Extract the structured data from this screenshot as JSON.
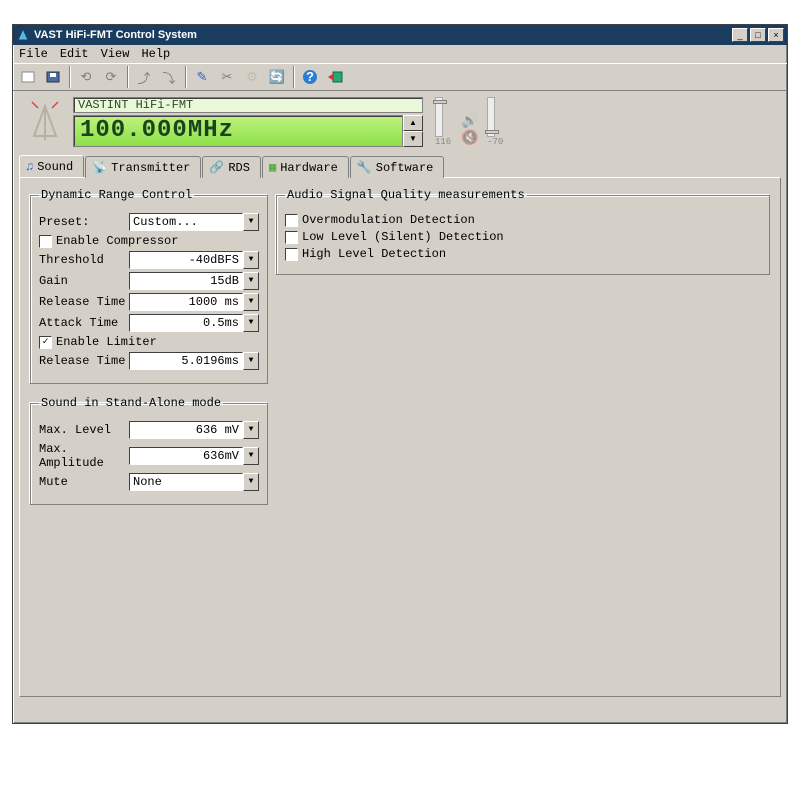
{
  "window": {
    "title": "VAST HiFi-FMT Control System"
  },
  "menus": {
    "file": "File",
    "edit": "Edit",
    "view": "View",
    "help": "Help"
  },
  "lcd": {
    "line1": "VASTINT HiFi-FMT",
    "freq": "100.000MHz"
  },
  "meters": {
    "left_val": "116",
    "right_val": "-70"
  },
  "tabs": {
    "sound": "Sound",
    "transmitter": "Transmitter",
    "rds": "RDS",
    "hardware": "Hardware",
    "software": "Software"
  },
  "groups": {
    "drc": "Dynamic Range Control",
    "standalone": "Sound in Stand-Alone mode",
    "quality": "Audio Signal Quality measurements"
  },
  "drc": {
    "preset_label": "Preset:",
    "preset_value": "Custom...",
    "enable_compressor": "Enable Compressor",
    "threshold_label": "Threshold",
    "threshold_value": "-40dBFS",
    "gain_label": "Gain",
    "gain_value": "15dB",
    "release1_label": "Release Time",
    "release1_value": "1000 ms",
    "attack_label": "Attack Time",
    "attack_value": "0.5ms",
    "enable_limiter": "Enable Limiter",
    "enable_limiter_checked": "✓",
    "release2_label": "Release Time",
    "release2_value": "5.0196ms"
  },
  "standalone": {
    "maxlevel_label": "Max. Level",
    "maxlevel_value": "636 mV",
    "maxamp_label": "Max. Amplitude",
    "maxamp_value": "636mV",
    "mute_label": "Mute",
    "mute_value": "None"
  },
  "quality": {
    "overmod": "Overmodulation Detection",
    "lowlevel": "Low Level (Silent) Detection",
    "highlevel": "High Level Detection"
  },
  "glyphs": {
    "minimize": "_",
    "maximize": "□",
    "close": "×",
    "up": "▲",
    "down": "▼"
  }
}
